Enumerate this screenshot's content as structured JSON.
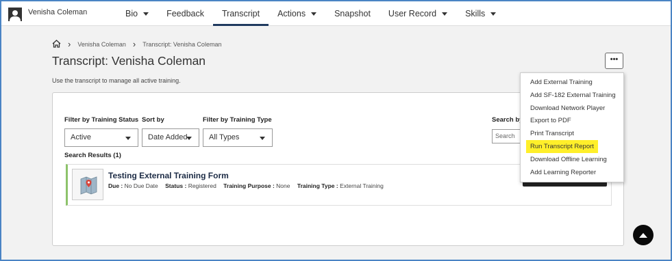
{
  "user": {
    "name": "Venisha Coleman"
  },
  "nav": {
    "tabs": [
      {
        "label": "Bio",
        "dropdown": true
      },
      {
        "label": "Feedback",
        "dropdown": false
      },
      {
        "label": "Transcript",
        "dropdown": false,
        "active": true
      },
      {
        "label": "Actions",
        "dropdown": true
      },
      {
        "label": "Snapshot",
        "dropdown": false
      },
      {
        "label": "User Record",
        "dropdown": true
      },
      {
        "label": "Skills",
        "dropdown": true
      }
    ]
  },
  "breadcrumb": {
    "home_icon": "home-icon",
    "items": [
      "Venisha Coleman",
      "Transcript: Venisha Coleman"
    ]
  },
  "page": {
    "title": "Transcript: Venisha Coleman",
    "description": "Use the transcript to manage all active training.",
    "more_button": "•••"
  },
  "filters": {
    "status": {
      "label": "Filter by Training Status",
      "value": "Active"
    },
    "sort": {
      "label": "Sort by",
      "value": "Date Added"
    },
    "type": {
      "label": "Filter by Training Type",
      "value": "All Types"
    },
    "search": {
      "label": "Search by",
      "placeholder": "Search"
    }
  },
  "results": {
    "label": "Search Results (1)",
    "items": [
      {
        "title": "Testing External Training Form",
        "due_label": "Due :",
        "due": "No Due Date",
        "status_label": "Status :",
        "status": "Registered",
        "purpose_label": "Training Purpose :",
        "purpose": "None",
        "type_label": "Training Type :",
        "type": "External Training"
      }
    ]
  },
  "menu": {
    "items": [
      "Add External Training",
      "Add SF-182 External Training",
      "Download Network Player",
      "Export to PDF",
      "Print Transcript",
      "Run Transcript Report",
      "Download Offline Learning",
      "Add Learning Reporter"
    ],
    "highlighted_index": 5,
    "highlight_color": "#ffef2a"
  },
  "colors": {
    "frame_border": "#4a84c4",
    "active_tab": "#1f3a5f",
    "row_accent": "#8dc36b"
  }
}
